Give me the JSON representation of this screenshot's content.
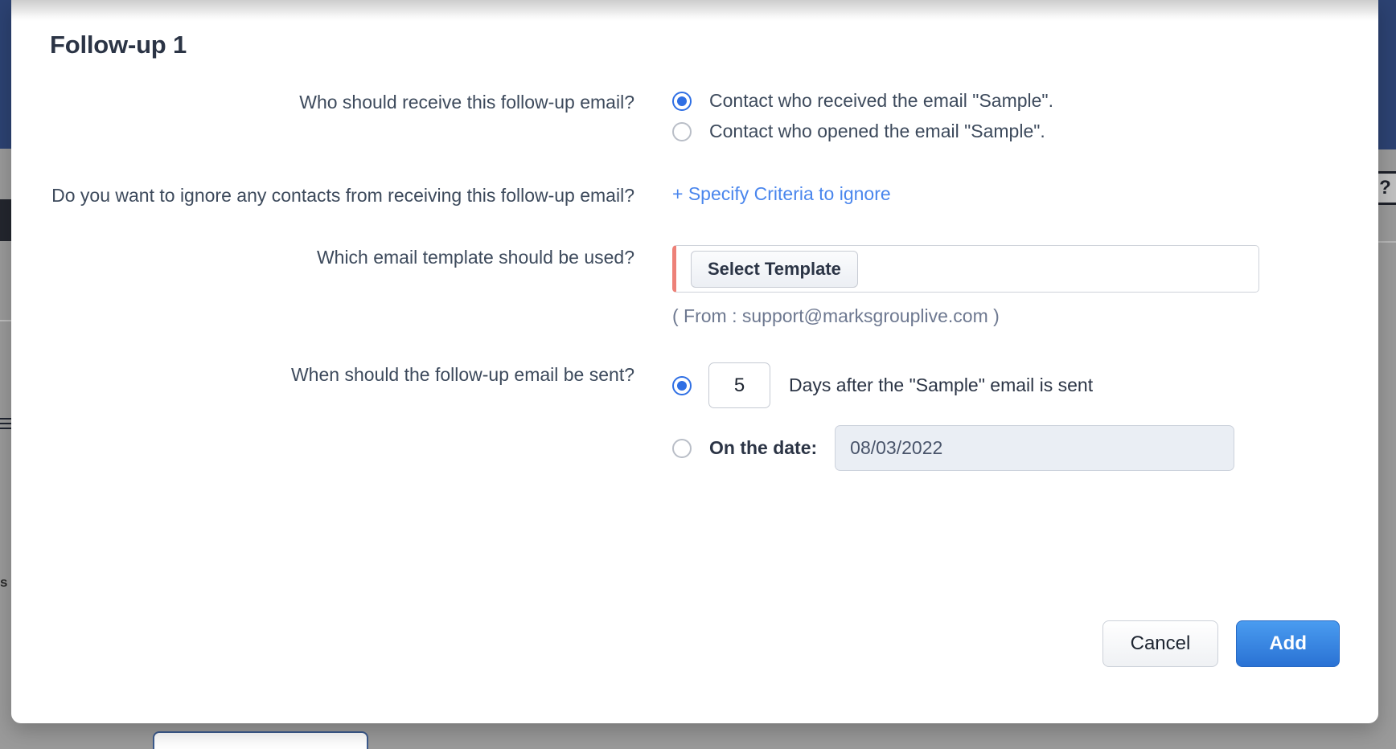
{
  "modal": {
    "title": "Follow-up 1",
    "questions": {
      "recipient_label": "Who should receive this follow-up email?",
      "ignore_label": "Do you want to ignore any contacts from receiving this follow-up email?",
      "template_label": "Which email template should be used?",
      "timing_label": "When should the follow-up email  be sent?"
    },
    "recipient_options": [
      {
        "label": "Contact who received the email \"Sample\".",
        "selected": true
      },
      {
        "label": "Contact who opened the email \"Sample\".",
        "selected": false
      }
    ],
    "ignore_link": "+ Specify Criteria to ignore",
    "template": {
      "button_label": "Select Template",
      "from_note": "( From : support@marksgrouplive.com )",
      "required": true,
      "required_color": "#ed8178"
    },
    "timing": {
      "days_option_selected": true,
      "days_value": "5",
      "days_suffix": "Days after the \"Sample\" email is sent",
      "date_option_selected": false,
      "date_label": "On the date:",
      "date_value": "08/03/2022"
    },
    "footer": {
      "cancel_label": "Cancel",
      "add_label": "Add"
    }
  },
  "background": {
    "navy_color": "#2c4272",
    "surface_color": "#9a9a9a",
    "help_icon": "?"
  },
  "colors": {
    "accent_blue": "#2f6fe4",
    "link_blue": "#4a86ed",
    "text_dark": "#2b3445",
    "text_muted": "#6d7890"
  }
}
